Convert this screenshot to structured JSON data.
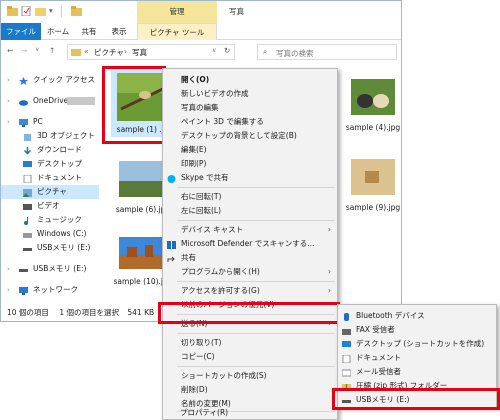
{
  "window": {
    "title": "写真",
    "ribbon_context_group": "管理",
    "tabs": [
      "ファイル",
      "ホーム",
      "共有",
      "表示",
      "ピクチャ ツール"
    ],
    "address": [
      "«",
      "ピクチャ",
      "›",
      "写真"
    ],
    "search_placeholder": "写真の検索",
    "nav_buttons": [
      "←",
      "→",
      "∨",
      "↑"
    ]
  },
  "sidebar": {
    "items": [
      {
        "label": "クイック アクセス",
        "icon": "star-icon"
      },
      {
        "label": "OneDrive -",
        "icon": "cloud-icon"
      },
      {
        "label": "PC",
        "icon": "pc-icon"
      },
      {
        "label": "3D オブジェクト",
        "icon": "cube-icon"
      },
      {
        "label": "ダウンロード",
        "icon": "download-icon"
      },
      {
        "label": "デスクトップ",
        "icon": "desktop-icon"
      },
      {
        "label": "ドキュメント",
        "icon": "document-icon"
      },
      {
        "label": "ピクチャ",
        "icon": "pictures-icon"
      },
      {
        "label": "ビデオ",
        "icon": "video-icon"
      },
      {
        "label": "ミュージック",
        "icon": "music-icon"
      },
      {
        "label": "Windows (C:)",
        "icon": "drive-icon"
      },
      {
        "label": "USBメモリ (E:)",
        "icon": "usb-icon"
      },
      {
        "label": "USBメモリ (E:)",
        "icon": "usb-icon"
      },
      {
        "label": "ネットワーク",
        "icon": "network-icon"
      }
    ]
  },
  "files": [
    {
      "name": "sample (1) .jpg"
    },
    {
      "name": "sample (4).jpg"
    },
    {
      "name": "sample (6).jpg"
    },
    {
      "name": "sample (9).jpg"
    },
    {
      "name": "sample (10).jpg"
    }
  ],
  "status": {
    "count": "10 個の項目",
    "selection": "1 個の項目を選択",
    "size": "541 KB"
  },
  "context_menu": [
    {
      "label": "開く(O)",
      "bold": true
    },
    {
      "label": "新しいビデオの作成"
    },
    {
      "label": "写真の編集"
    },
    {
      "label": "ペイント 3D で編集する"
    },
    {
      "label": "デスクトップの背景として設定(B)"
    },
    {
      "label": "編集(E)"
    },
    {
      "label": "印刷(P)"
    },
    {
      "label": "Skype で共有",
      "icon": "skype-icon"
    },
    {
      "label": "右に回転(T)"
    },
    {
      "label": "左に回転(L)"
    },
    {
      "label": "デバイス キャスト",
      "submenu": true
    },
    {
      "label": "Microsoft Defender でスキャンする...",
      "icon": "defender-icon"
    },
    {
      "label": "共有",
      "icon": "share-icon"
    },
    {
      "label": "プログラムから開く(H)",
      "submenu": true
    },
    {
      "label": "アクセスを許可する(G)",
      "submenu": true
    },
    {
      "label": "以前のバージョンの復元(V)"
    },
    {
      "label": "送る(N)",
      "submenu": true
    },
    {
      "label": "切り取り(T)"
    },
    {
      "label": "コピー(C)"
    },
    {
      "label": "ショートカットの作成(S)"
    },
    {
      "label": "削除(D)"
    },
    {
      "label": "名前の変更(M)"
    },
    {
      "label": "プロパティ(R)"
    }
  ],
  "send_to_menu": [
    {
      "label": "Bluetooth デバイス",
      "icon": "bluetooth-icon"
    },
    {
      "label": "FAX 受信者",
      "icon": "fax-icon"
    },
    {
      "label": "デスクトップ (ショートカットを作成)",
      "icon": "desktop-icon"
    },
    {
      "label": "ドキュメント",
      "icon": "document-icon"
    },
    {
      "label": "メール受信者",
      "icon": "mail-icon"
    },
    {
      "label": "圧縮 (zip 形式) フォルダー",
      "icon": "zip-icon"
    },
    {
      "label": "USBメモリ (E:)",
      "icon": "usb-icon"
    }
  ],
  "colors": {
    "highlight": "#e60012",
    "accent": "#1979ca",
    "selection": "#cce8ff"
  }
}
